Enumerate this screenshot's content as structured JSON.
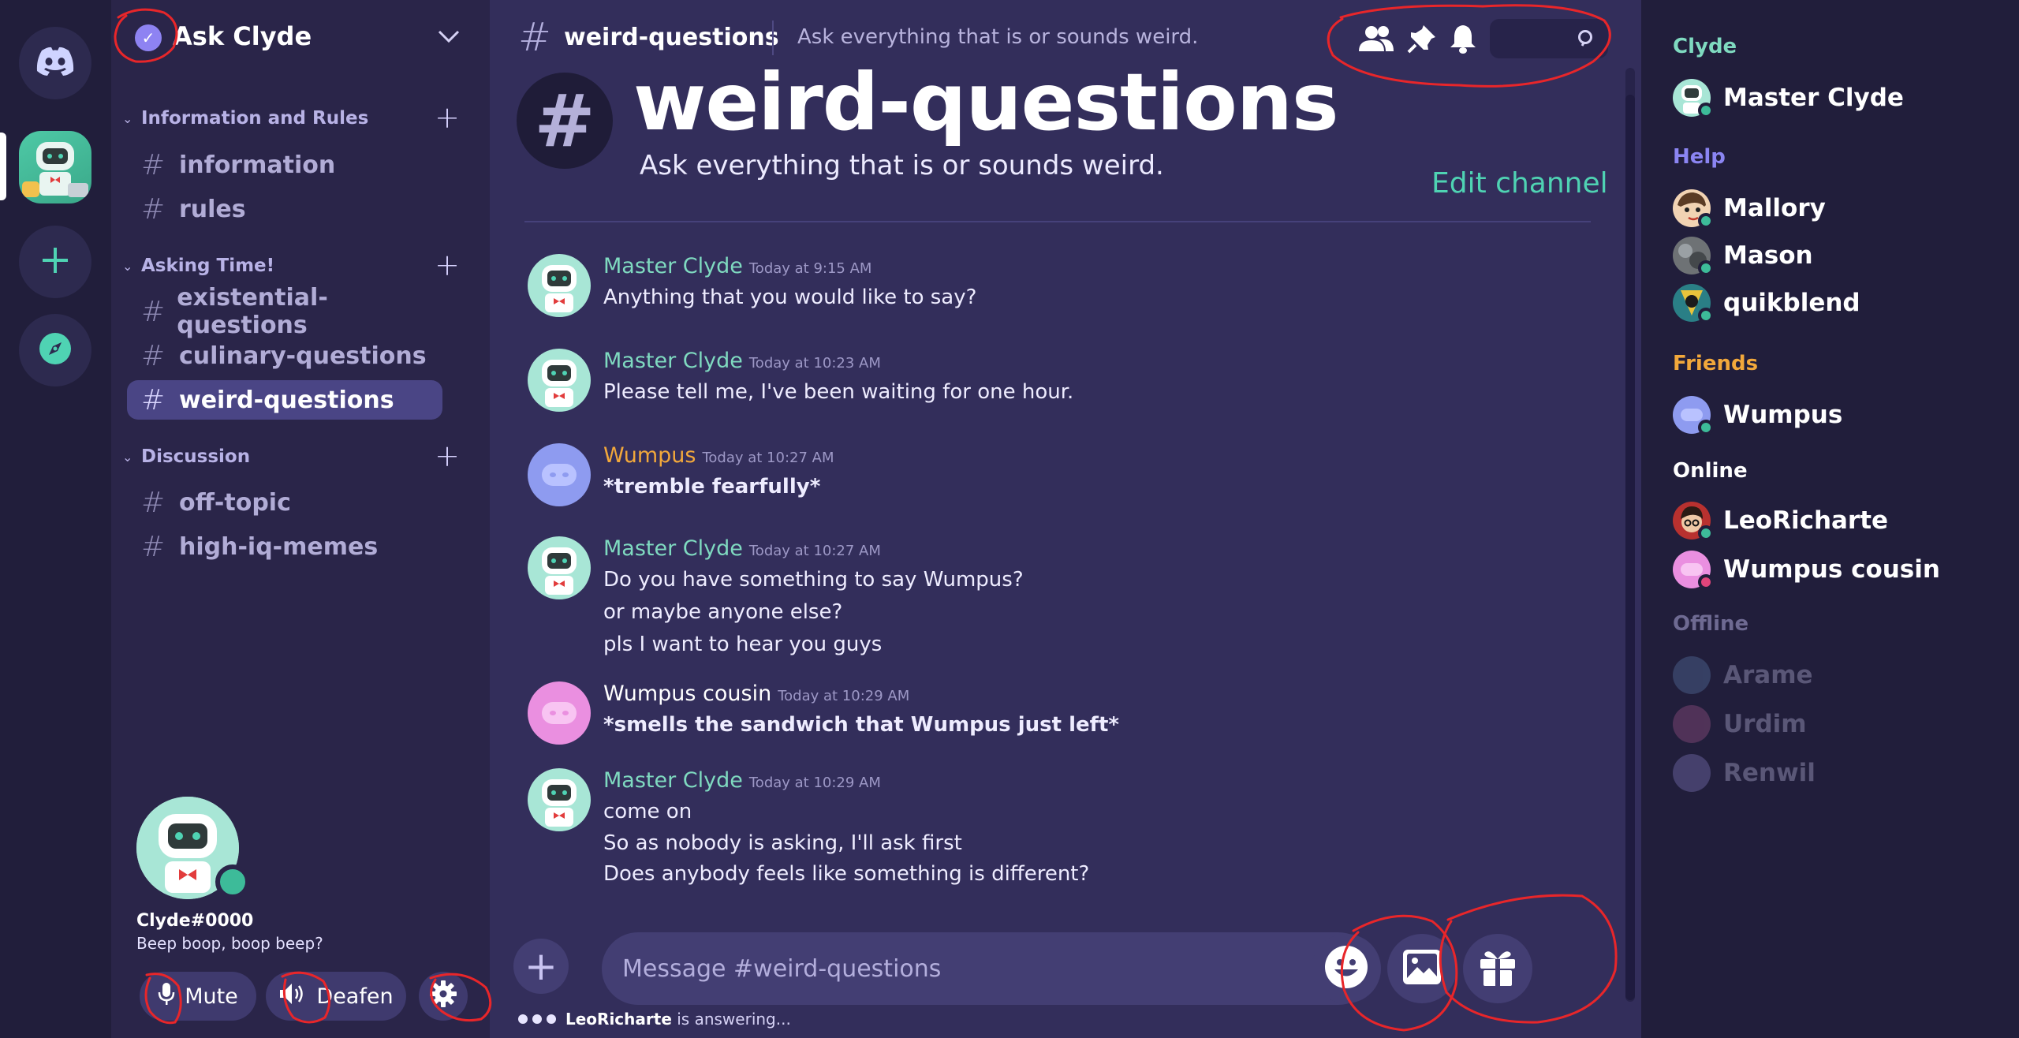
{
  "server": {
    "name": "Ask Clyde",
    "categories": [
      {
        "name": "Information and Rules",
        "channels": [
          "information",
          "rules"
        ]
      },
      {
        "name": "Asking Time!",
        "channels": [
          "existential-questions",
          "culinary-questions",
          "weird-questions"
        ]
      },
      {
        "name": "Discussion",
        "channels": [
          "off-topic",
          "high-iq-memes"
        ]
      }
    ],
    "active_channel": "weird-questions"
  },
  "user": {
    "tag": "Clyde#0000",
    "status": "Beep boop, boop beep?",
    "mute_label": "Mute",
    "deafen_label": "Deafen"
  },
  "channel": {
    "name": "weird-questions",
    "topic": "Ask everything that is or sounds weird.",
    "welcome_title": "weird-questions",
    "welcome_subtitle": "Ask everything that is or sounds weird.",
    "edit_label": "Edit channel"
  },
  "messages": [
    {
      "author": "Master Clyde",
      "color": "#7fdac0",
      "time": "Today at 9:15 AM",
      "lines": [
        "Anything that you would like to say?"
      ],
      "bold": false
    },
    {
      "author": "Master Clyde",
      "color": "#7fdac0",
      "time": "Today at 10:23 AM",
      "lines": [
        "Please tell me, I've been waiting for one hour."
      ],
      "bold": false
    },
    {
      "author": "Wumpus",
      "color": "#f2a83b",
      "time": "Today at 10:27 AM",
      "lines": [
        "*tremble fearfully*"
      ],
      "bold": true
    },
    {
      "author": "Master Clyde",
      "color": "#7fdac0",
      "time": "Today at 10:27 AM",
      "lines": [
        "Do you have something to say Wumpus?",
        "or maybe anyone else?",
        "pls I want to hear you guys"
      ],
      "bold": false
    },
    {
      "author": "Wumpus cousin",
      "color": "#ffffff",
      "time": "Today at 10:29 AM",
      "lines": [
        "*smells the sandwich that Wumpus just left*"
      ],
      "bold": true
    },
    {
      "author": "Master Clyde",
      "color": "#7fdac0",
      "time": "Today at 10:29 AM",
      "lines": [
        "come on",
        "So as nobody is asking, I'll ask first",
        "Does anybody feels like something is different?"
      ],
      "bold": false
    }
  ],
  "composer": {
    "placeholder": "Message #weird-questions",
    "typing_user": "LeoRicharte",
    "typing_suffix": " is answering..."
  },
  "members": {
    "roles": [
      {
        "name": "Clyde",
        "color": "#7fdac0"
      },
      {
        "name": "Help",
        "color": "#8b85f2"
      },
      {
        "name": "Friends",
        "color": "#f2a83b"
      },
      {
        "name": "Online",
        "color": "#ffffff"
      },
      {
        "name": "Offline",
        "color": "#6e6a92"
      }
    ],
    "list": [
      "Master Clyde",
      "Mallory",
      "Mason",
      "quikblend",
      "Wumpus",
      "LeoRicharte",
      "Wumpus cousin",
      "Arame",
      "Urdim",
      "Renwil"
    ]
  },
  "colors": {
    "accent": "#4fd3b3",
    "online": "#3dbb99",
    "dnd": "#e0457b",
    "annotation": "#e8262a"
  }
}
